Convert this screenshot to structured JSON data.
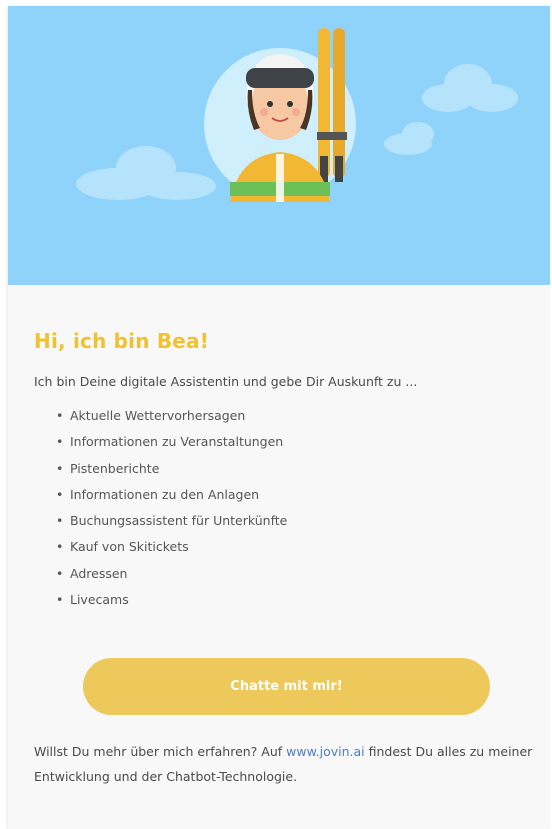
{
  "welcome": {
    "title": "Hi, ich bin Bea!",
    "intro": "Ich bin Deine digitale Assistentin und gebe Dir Auskunft zu ...",
    "features": [
      "Aktuelle Wettervorhersagen",
      "Informationen zu Veranstaltungen",
      "Pistenberichte",
      "Informationen zu den Anlagen",
      "Buchungsassistent für Unterkünfte",
      "Kauf von Skitickets",
      "Adressen",
      "Livecams"
    ],
    "cta_label": "Chatte mit mir!",
    "footer": {
      "text_before": "Willst Du mehr über mich erfahren? Auf ",
      "link_text": "www.jovin.ai",
      "text_after": " findest Du alles zu meiner Entwicklung und der Chatbot-Technologie."
    }
  },
  "colors": {
    "hero_sky": "#8fd3fb",
    "title": "#f2c12e",
    "cta_button": "#edc85a",
    "link": "#4a7fc1"
  },
  "icons": {
    "hero": "bea-skier-avatar-illustration"
  }
}
